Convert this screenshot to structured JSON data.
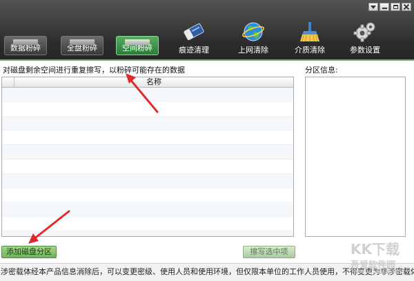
{
  "toolbar": {
    "tabs": [
      {
        "label": "数据粉碎",
        "icon": "drive-chip-icon"
      },
      {
        "label": "全盘粉碎",
        "icon": "drive-chip-icon"
      },
      {
        "label": "空间粉碎",
        "icon": "drive-chip-icon",
        "active": true
      },
      {
        "label": "痕迹清理",
        "icon": "eraser-icon"
      },
      {
        "label": "上网清除",
        "icon": "globe-icon"
      },
      {
        "label": "介质清除",
        "icon": "cleaning-brush-icon"
      },
      {
        "label": "参数设置",
        "icon": "gears-icon"
      }
    ]
  },
  "main": {
    "hint": "对磁盘剩余空间进行重复擦写，以粉碎可能存在的数据",
    "table": {
      "columns": [
        "",
        "名称"
      ],
      "rows": []
    },
    "partition_label": "分区信息:",
    "add_button": "添加磁盘分区",
    "erase_button": "擦写选中项"
  },
  "statusbar": {
    "text": "涉密载体经本产品信息消除后，可以变更密级、使用人员和使用环境，但仅限本单位的工作人员使用，不得变更为非涉密载体使用。"
  },
  "watermark": {
    "line1": "KK下载",
    "line2": "吾爱软件园",
    "line3": "www.52z.com"
  },
  "colors": {
    "accent_green": "#3a8a44",
    "annotation_red": "#e02a2a",
    "header_dark": "#2d2d2d"
  }
}
